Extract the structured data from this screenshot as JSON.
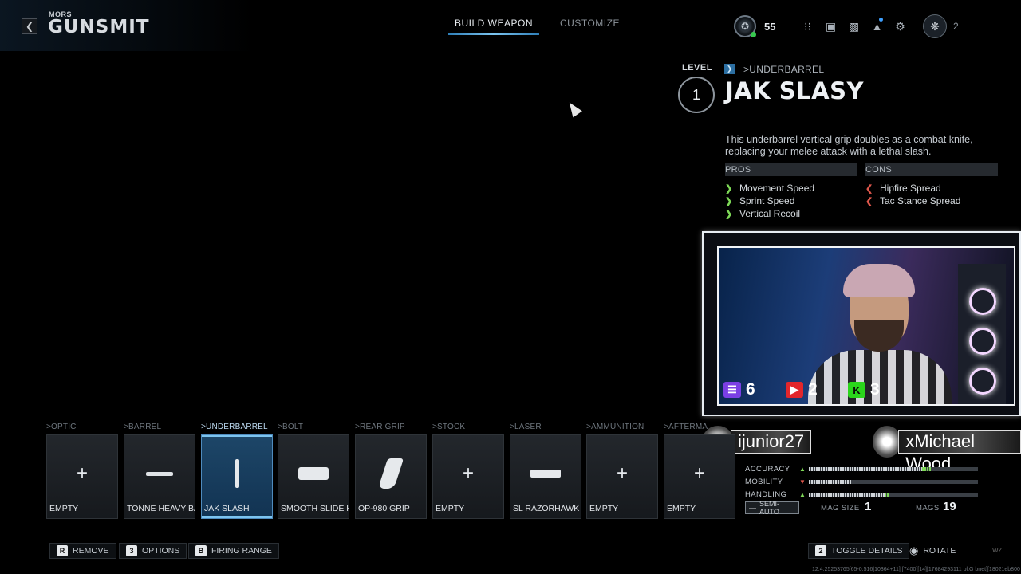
{
  "header": {
    "brand_sub": "MORS",
    "brand_title": "GUNSMIT",
    "tabs": [
      {
        "label": "BUILD WEAPON",
        "active": true
      },
      {
        "label": "CUSTOMIZE",
        "active": false
      }
    ],
    "player_level": "55",
    "player_count": "2",
    "icons": [
      "grid-icon",
      "lock-icon",
      "camera-icon",
      "bell-icon",
      "gear-icon"
    ]
  },
  "attachment": {
    "level_label": "LEVEL",
    "level": "1",
    "category": ">UNDERBARREL",
    "name": "JAK SLASY",
    "description": "This underbarrel vertical grip doubles as a combat knife, replacing your melee attack with a lethal slash.",
    "pros_label": "PROS",
    "cons_label": "CONS",
    "pros": [
      "Movement Speed",
      "Sprint Speed",
      "Vertical Recoil"
    ],
    "cons": [
      "Hipfire Spread",
      "Tac Stance Spread"
    ]
  },
  "webcam": {
    "twitch_count": "6",
    "youtube_count": "2",
    "kick_count": "3",
    "kick_letter": "K",
    "gamertags": [
      "ijunior27",
      "xMichael Wood"
    ]
  },
  "stats": {
    "rows": [
      {
        "label": "ACCURACY",
        "dir": "up",
        "value": 0.67,
        "delta": 0.05
      },
      {
        "label": "MOBILITY",
        "dir": "down",
        "value": 0.25,
        "delta": 0
      },
      {
        "label": "HANDLING",
        "dir": "up",
        "value": 0.45,
        "delta": 0.02
      }
    ],
    "fire_mode": "SEMI-AUTO",
    "mag_size_label": "MAG SIZE",
    "mag_size": "1",
    "mags_label": "MAGS",
    "mags": "19"
  },
  "slots": [
    {
      "category": ">OPTIC",
      "name": "EMPTY",
      "icon": "plus-icon",
      "selected": false
    },
    {
      "category": ">BARREL",
      "name": "TONNE HEAVY BA",
      "icon": "barrel-icon",
      "selected": false
    },
    {
      "category": ">UNDERBARREL",
      "name": "JAK SLASH",
      "icon": "grip-icon",
      "selected": true
    },
    {
      "category": ">BOLT",
      "name": "SMOOTH SLIDE H",
      "icon": "bolt-icon",
      "selected": false
    },
    {
      "category": ">REAR GRIP",
      "name": "OP-980 GRIP",
      "icon": "rear-grip-icon",
      "selected": false
    },
    {
      "category": ">STOCK",
      "name": "EMPTY",
      "icon": "plus-icon",
      "selected": false
    },
    {
      "category": ">LASER",
      "name": "SL RAZORHAWK",
      "icon": "laser-icon",
      "selected": false
    },
    {
      "category": ">AMMUNITION",
      "name": "EMPTY",
      "icon": "plus-icon",
      "selected": false
    },
    {
      "category": ">AFTERMA",
      "name": "EMPTY",
      "icon": "plus-icon",
      "selected": false
    }
  ],
  "footer": {
    "remove": {
      "key": "R",
      "label": "REMOVE"
    },
    "options": {
      "key": "3",
      "label": "OPTIONS"
    },
    "firing_range": {
      "key": "B",
      "label": "FIRING RANGE"
    },
    "toggle_details": {
      "key": "2",
      "label": "TOGGLE DETAILS"
    },
    "rotate": {
      "label": "ROTATE"
    },
    "wz": "WZ",
    "build_id": "12.4.25253765[65-0.516|10364+11] [7400][14][17684293111 pl.G bnet][18021eb800"
  },
  "colors": {
    "accent": "#7cc4ef",
    "selected_slot": "#1d4668",
    "pro": "#7ed957",
    "con": "#e0574c"
  }
}
